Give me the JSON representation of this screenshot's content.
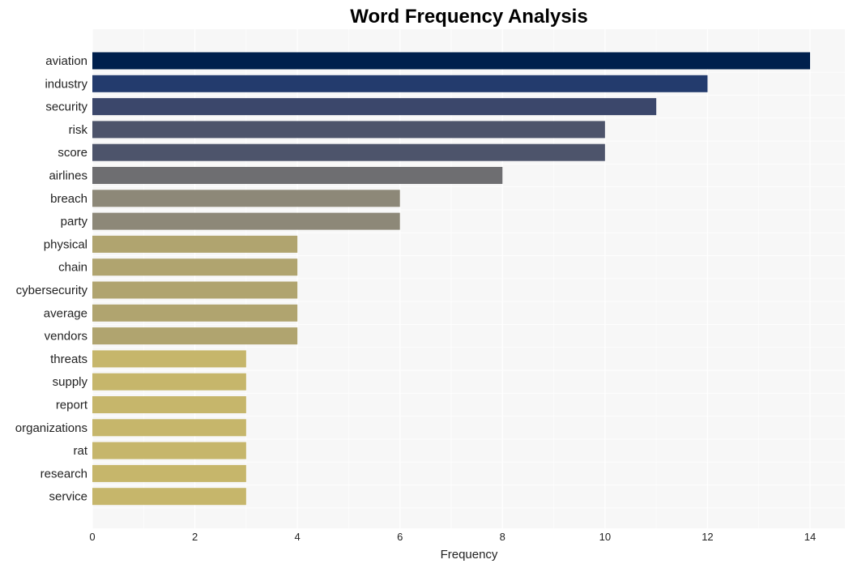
{
  "chart_data": {
    "type": "bar",
    "orientation": "horizontal",
    "title": "Word Frequency Analysis",
    "xlabel": "Frequency",
    "ylabel": "",
    "xlim": [
      0,
      14.7
    ],
    "xticks": [
      0,
      2,
      4,
      6,
      8,
      10,
      12,
      14
    ],
    "grid": true,
    "categories": [
      "aviation",
      "industry",
      "security",
      "risk",
      "score",
      "airlines",
      "breach",
      "party",
      "physical",
      "chain",
      "cybersecurity",
      "average",
      "vendors",
      "threats",
      "supply",
      "report",
      "organizations",
      "rat",
      "research",
      "service"
    ],
    "values": [
      14,
      12,
      11,
      10,
      10,
      8,
      6,
      6,
      4,
      4,
      4,
      4,
      4,
      3,
      3,
      3,
      3,
      3,
      3,
      3
    ],
    "colors": [
      "#00204d",
      "#233b6d",
      "#3b476b",
      "#4d546b",
      "#4d546b",
      "#6e6e71",
      "#8d8878",
      "#8d8878",
      "#b0a46f",
      "#b0a46f",
      "#b0a46f",
      "#b0a46f",
      "#b0a46f",
      "#c6b66b",
      "#c6b66b",
      "#c6b66b",
      "#c6b66b",
      "#c6b66b",
      "#c6b66b",
      "#c6b66b"
    ],
    "background": "#f7f7f7"
  }
}
